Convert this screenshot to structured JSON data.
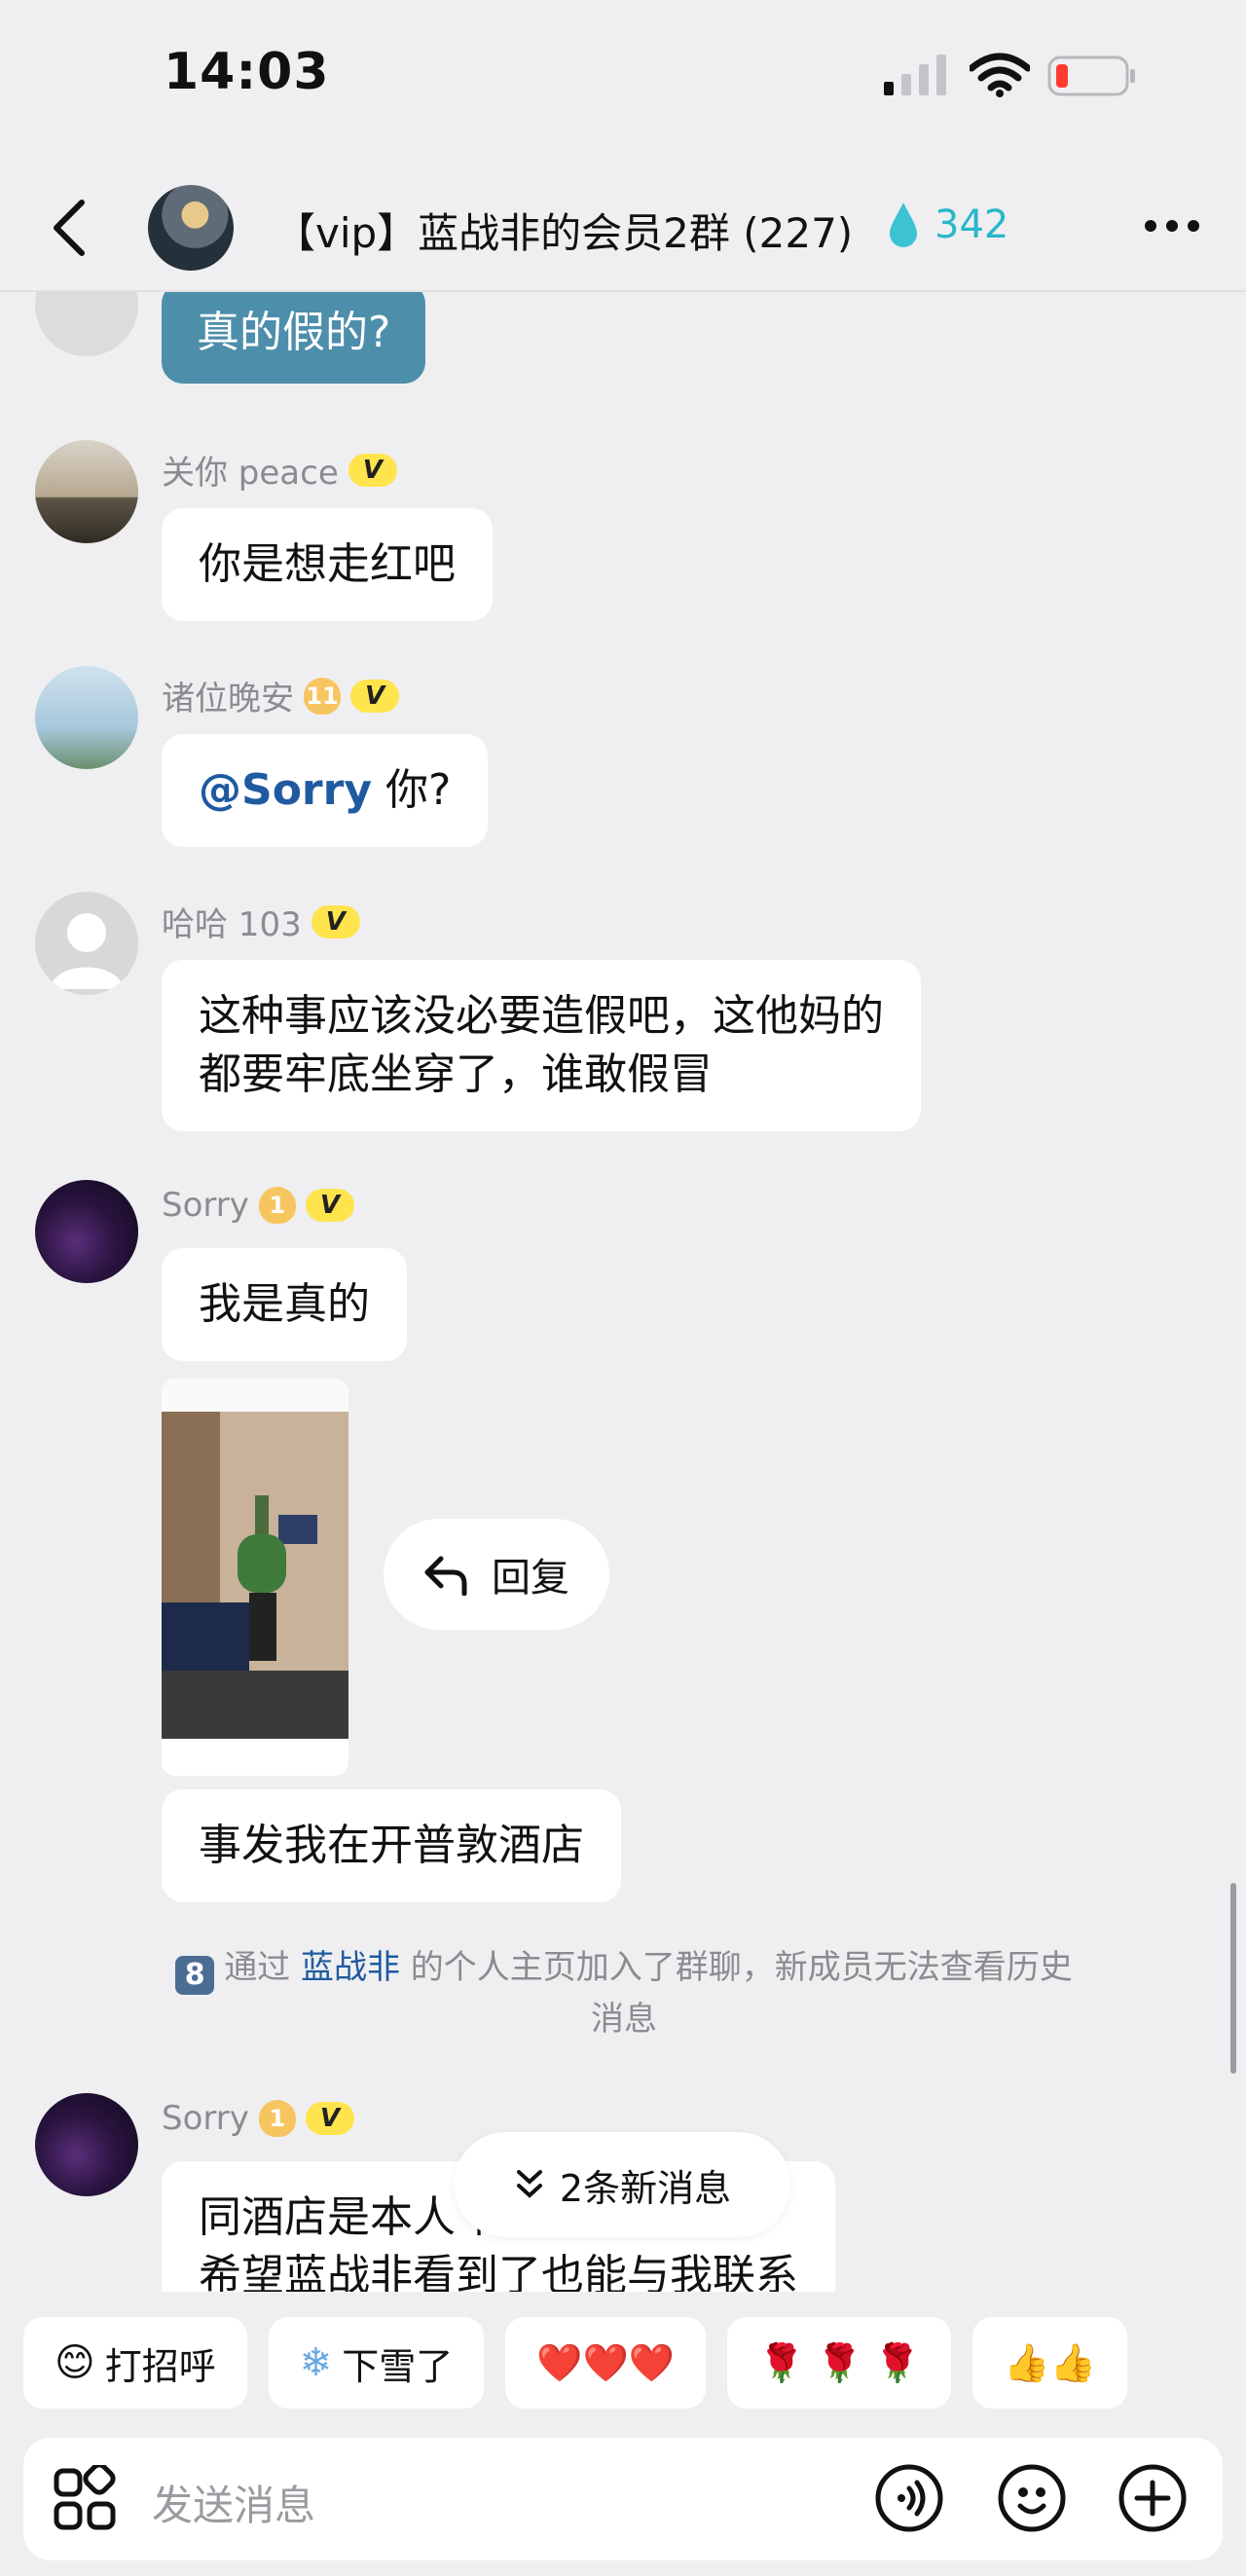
{
  "status_bar": {
    "time": "14:03"
  },
  "header": {
    "title": "【vip】蓝战非的会员2群 (227)",
    "heat": "342"
  },
  "messages": [
    {
      "text": "真的假的?"
    },
    {
      "name": "关你 peace",
      "v": "V",
      "text": "你是想走红吧"
    },
    {
      "name": "诸位晚安",
      "level": "11",
      "v": "V",
      "mention": "@Sorry",
      "text": " 你?"
    },
    {
      "name": "哈哈 103",
      "v": "V",
      "line1": "这种事应该没必要造假吧，这他妈的",
      "line2": "都要牢底坐穿了，谁敢假冒"
    },
    {
      "name": "Sorry",
      "level": "1",
      "v": "V",
      "text": "我是真的",
      "reply": "回复",
      "text2": "事发我在开普敦酒店"
    },
    {
      "name": "Sorry",
      "level": "1",
      "v": "V",
      "line1": "同酒店是本人 行程有差。",
      "line2": "希望蓝战非看到了也能与我联系"
    }
  ],
  "system": {
    "badge": "8",
    "prefix": "通过 ",
    "link": "蓝战非",
    "suffix": " 的个人主页加入了群聊，新成员无法查看历史",
    "line2": "消息"
  },
  "new_messages": "2条新消息",
  "quick_replies": [
    {
      "icon": "wave-emoji",
      "label": "打招呼"
    },
    {
      "icon": "snowflake-emoji",
      "label": "下雪了"
    },
    {
      "icon": "hearts-emoji",
      "label": "❤️❤️❤️"
    },
    {
      "icon": "roses-emoji",
      "label": "🌹 🌹 🌹"
    },
    {
      "icon": "thumbs-emoji",
      "label": "👍👍"
    }
  ],
  "input": {
    "placeholder": "发送消息"
  }
}
